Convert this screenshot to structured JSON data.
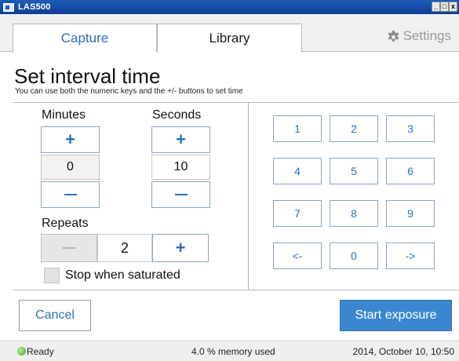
{
  "window": {
    "title": "LAS500",
    "minimize_label": "_",
    "maximize_label": "□",
    "close_label": "x"
  },
  "tabs": [
    {
      "label": "Capture",
      "active": true
    },
    {
      "label": "Library",
      "active": false
    }
  ],
  "settings": {
    "label": "Settings",
    "icon": "gear-icon"
  },
  "heading": {
    "title": "Set interval time",
    "subtitle": "You can use both the numeric keys and the +/- buttons to set time"
  },
  "minutes": {
    "label": "Minutes",
    "value": "0",
    "plus": "+",
    "minus": "−"
  },
  "seconds": {
    "label": "Seconds",
    "value": "10",
    "plus": "+",
    "minus": "−"
  },
  "repeats": {
    "label": "Repeats",
    "value": "2",
    "plus": "+",
    "minus": "−",
    "minus_disabled": true
  },
  "stop_when_saturated": {
    "label": "Stop when saturated",
    "checked": false
  },
  "keypad": {
    "keys": [
      "1",
      "2",
      "3",
      "4",
      "5",
      "6",
      "7",
      "8",
      "9",
      "<-",
      "0",
      "->"
    ]
  },
  "actions": {
    "cancel": "Cancel",
    "start": "Start exposure"
  },
  "status": {
    "state": "Ready",
    "memory": "4.0 % memory used",
    "datetime": "2014, October 10, 10:50"
  },
  "colors": {
    "accent": "#2b6fbf",
    "primary_button": "#3a87cf",
    "title_bar": "#1d5bb8",
    "status_ok": "#3da62a"
  }
}
